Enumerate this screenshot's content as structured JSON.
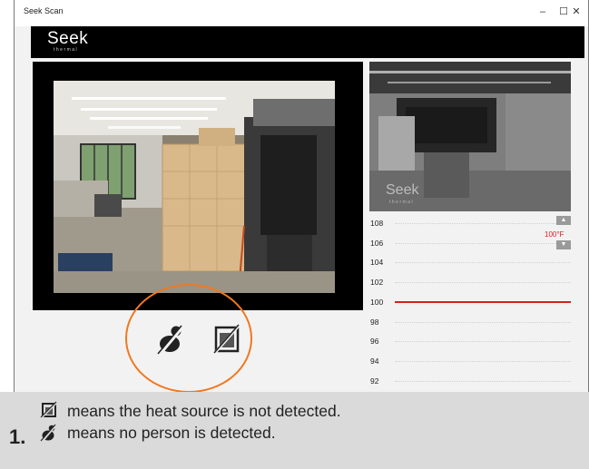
{
  "window": {
    "title": "Seek Scan",
    "minimize_glyph": "–",
    "maximize_glyph": "☐",
    "close_glyph": "✕"
  },
  "brand": {
    "logo": "Seek",
    "sublogo": "thermal"
  },
  "thermal_view": {
    "logo": "Seek",
    "sublogo": "thermal"
  },
  "status_icons": {
    "person": "no-person-detected-icon",
    "heat": "heat-not-detected-icon"
  },
  "temperature": {
    "threshold_label": "100°F",
    "threshold_value": 100,
    "ticks": [
      "108",
      "106",
      "104",
      "102",
      "100",
      "98",
      "96",
      "94",
      "92"
    ],
    "up_glyph": "▲",
    "down_glyph": "▼",
    "accent_color": "#d62020"
  },
  "highlight_color": "#f07820",
  "caption": {
    "number": "1.",
    "line1": "means the heat source is not detected.",
    "line2": "means no person is detected."
  }
}
